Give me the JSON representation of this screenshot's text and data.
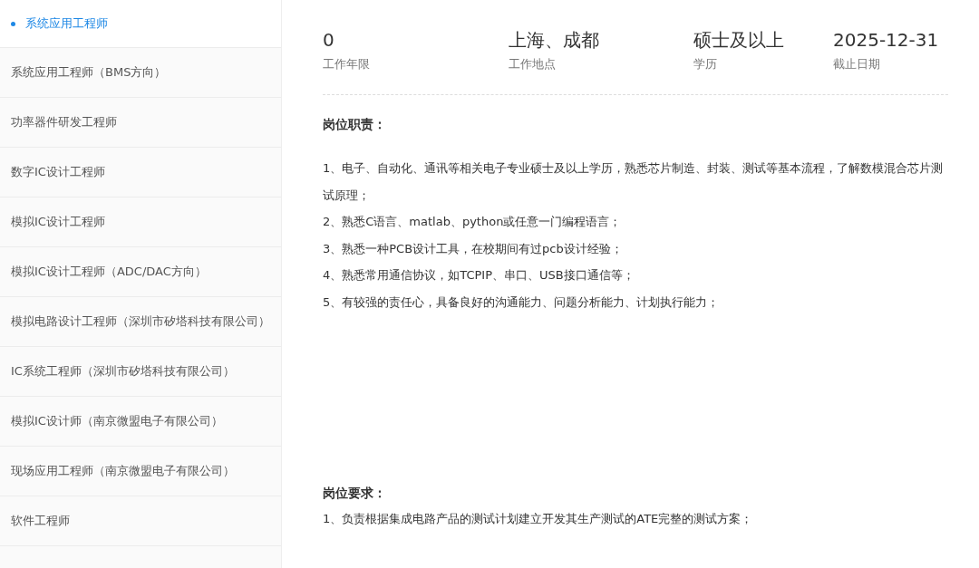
{
  "sidebar": {
    "items": [
      {
        "label": "系统应用工程师",
        "selected": true
      },
      {
        "label": "系统应用工程师（BMS方向）",
        "selected": false
      },
      {
        "label": "功率器件研发工程师",
        "selected": false
      },
      {
        "label": "数字IC设计工程师",
        "selected": false
      },
      {
        "label": "模拟IC设计工程师",
        "selected": false
      },
      {
        "label": "模拟IC设计工程师（ADC/DAC方向）",
        "selected": false
      },
      {
        "label": "模拟电路设计工程师（深圳市矽塔科技有限公司）",
        "selected": false
      },
      {
        "label": "IC系统工程师（深圳市矽塔科技有限公司）",
        "selected": false
      },
      {
        "label": "模拟IC设计师（南京微盟电子有限公司）",
        "selected": false
      },
      {
        "label": "现场应用工程师（南京微盟电子有限公司）",
        "selected": false
      },
      {
        "label": "软件工程师",
        "selected": false
      }
    ]
  },
  "summary": [
    {
      "value": "0",
      "label": "工作年限"
    },
    {
      "value": "上海、成都",
      "label": "工作地点"
    },
    {
      "value": "硕士及以上",
      "label": "学历"
    },
    {
      "value": "2025-12-31",
      "label": "截止日期"
    }
  ],
  "sections": [
    {
      "heading": "岗位职责：",
      "lines": [
        "1、电子、自动化、通讯等相关电子专业硕士及以上学历，熟悉芯片制造、封装、测试等基本流程，了解数模混合芯片测试原理；",
        "2、熟悉C语言、matlab、python或任意一门编程语言；",
        "3、熟悉一种PCB设计工具，在校期间有过pcb设计经验；",
        "4、熟悉常用通信协议，如TCPIP、串口、USB接口通信等；",
        "5、有较强的责任心，具备良好的沟通能力、问题分析能力、计划执行能力；"
      ]
    },
    {
      "heading": "岗位要求：",
      "lines": [
        "1、负责根据集成电路产品的测试计划建立开发其生产测试的ATE完整的测试方案；"
      ]
    }
  ]
}
